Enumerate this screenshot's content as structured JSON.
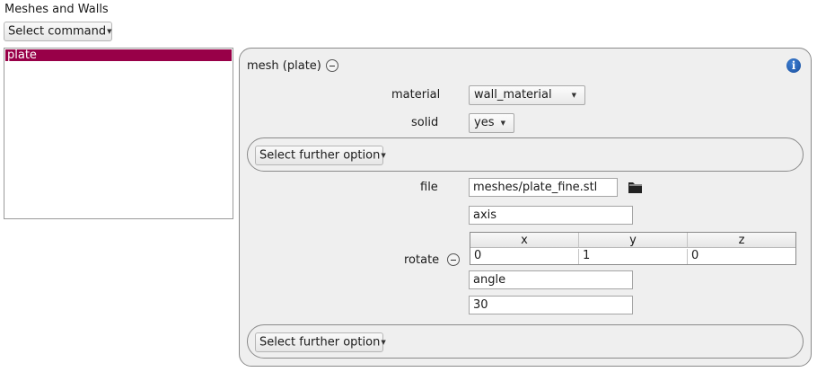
{
  "window_title": "Meshes and Walls",
  "select_command": {
    "label": "Select command"
  },
  "items": [
    {
      "label": "plate",
      "selected": true
    }
  ],
  "panel": {
    "title": "mesh (plate)",
    "material": {
      "label": "material",
      "value": "wall_material"
    },
    "solid": {
      "label": "solid",
      "value": "yes"
    },
    "further_option_label": "Select further option",
    "file": {
      "label": "file",
      "value": "meshes/plate_fine.stl"
    },
    "rotate": {
      "label": "rotate",
      "axis_label": "axis",
      "axis_columns": [
        "x",
        "y",
        "z"
      ],
      "axis_values": [
        "0",
        "1",
        "0"
      ],
      "angle_label": "angle",
      "angle_value": "30"
    }
  },
  "colors": {
    "selection": "#980048",
    "info_icon": "#1a4f9c"
  },
  "icons": [
    "minus-circle-icon",
    "info-icon",
    "folder-icon",
    "caret-down-icon"
  ]
}
